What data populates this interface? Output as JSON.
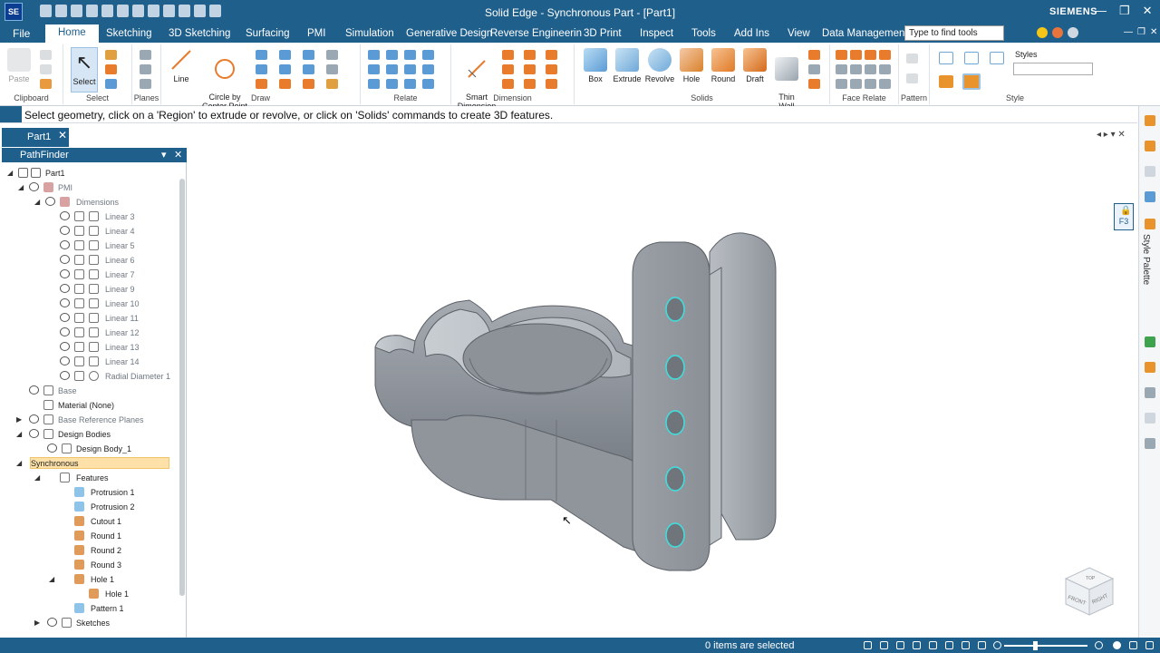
{
  "app": {
    "logo": "SE",
    "title": "Solid Edge - Synchronous Part - [Part1]",
    "brand": "SIEMENS",
    "window_controls": [
      "—",
      "❐",
      "✕"
    ],
    "mdi_controls": [
      "—",
      "❐",
      "✕"
    ]
  },
  "menu": {
    "file": "File",
    "tabs": [
      "Home",
      "Sketching",
      "3D Sketching",
      "Surfacing",
      "PMI",
      "Simulation",
      "Generative Design",
      "Reverse Engineerin",
      "3D Print",
      "Inspect",
      "Tools",
      "Add Ins",
      "View",
      "Data Management"
    ],
    "active_tab": "Home",
    "search_placeholder": "Type to find tools"
  },
  "ribbon": {
    "groups": [
      "Clipboard",
      "Select",
      "Planes",
      "Draw",
      "Relate",
      "Dimension",
      "Solids",
      "Face Relate",
      "Pattern",
      "Style"
    ],
    "buttons": {
      "paste": "Paste",
      "select": "Select",
      "line": "Line",
      "circle": "Circle by\nCenter Point",
      "smart_dimension": "Smart\nDimension",
      "box": "Box",
      "extrude": "Extrude",
      "revolve": "Revolve",
      "hole": "Hole",
      "round": "Round",
      "draft": "Draft",
      "thin_wall": "Thin\nWall",
      "styles": "Styles"
    }
  },
  "prompt": "Select geometry, click on a 'Region' to extrude or revolve, or click on 'Solids' commands to create 3D features.",
  "document_tab": "Part1",
  "pathfinder": {
    "title": "PathFinder",
    "items": [
      {
        "label": "Part1"
      },
      {
        "label": "PMI"
      },
      {
        "label": "Dimensions"
      },
      {
        "label": "Linear 3"
      },
      {
        "label": "Linear 4"
      },
      {
        "label": "Linear 5"
      },
      {
        "label": "Linear 6"
      },
      {
        "label": "Linear 7"
      },
      {
        "label": "Linear 9"
      },
      {
        "label": "Linear 10"
      },
      {
        "label": "Linear 11"
      },
      {
        "label": "Linear 12"
      },
      {
        "label": "Linear 13"
      },
      {
        "label": "Linear 14"
      },
      {
        "label": "Radial Diameter 1"
      },
      {
        "label": "Base"
      },
      {
        "label": "Material (None)"
      },
      {
        "label": "Base Reference Planes"
      },
      {
        "label": "Design Bodies"
      },
      {
        "label": "Design Body_1"
      },
      {
        "label": "Synchronous"
      },
      {
        "label": "Features"
      },
      {
        "label": "Protrusion 1"
      },
      {
        "label": "Protrusion 2"
      },
      {
        "label": "Cutout 1"
      },
      {
        "label": "Round 1"
      },
      {
        "label": "Round 2"
      },
      {
        "label": "Round 3"
      },
      {
        "label": "Hole 1"
      },
      {
        "label": "Hole 1"
      },
      {
        "label": "Pattern 1"
      },
      {
        "label": "Sketches"
      }
    ]
  },
  "right_panel": {
    "style_palette": "Style Palette",
    "lock_label": "F3"
  },
  "view_cube": {
    "top": "TOP",
    "front": "FRONT",
    "right": "RIGHT"
  },
  "status": {
    "text": "0 items are selected"
  },
  "colors": {
    "accent": "#1f5f8b",
    "highlight": "#fde1a8",
    "part_gray": "#8e949b"
  }
}
